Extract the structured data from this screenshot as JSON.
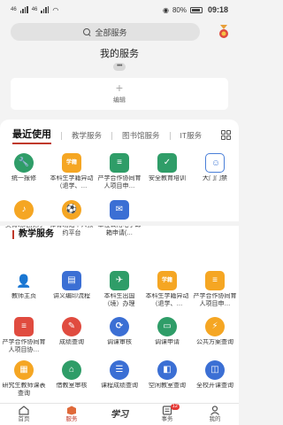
{
  "status_bar": {
    "network_left": "46",
    "network_right": "46",
    "battery": "80%",
    "time": "09:18"
  },
  "header": {
    "search_placeholder": "全部服务",
    "my_services_title": "我的服务",
    "more_dots": "•••",
    "edit_label": "编辑"
  },
  "tabs": {
    "active": "最近使用",
    "items": [
      "教学服务",
      "图书馆服务",
      "IT服务"
    ]
  },
  "recent_apps": [
    {
      "label": "统一报修",
      "icon": "wrench-icon",
      "color": "#2f9d68"
    },
    {
      "label": "本科生学籍异动（退学、…",
      "icon": "student-status-icon",
      "color": "#f5a623"
    },
    {
      "label": "产学合作协同育人项目申…",
      "icon": "document-icon",
      "color": "#2f9d68"
    },
    {
      "label": "安全教育培训",
      "icon": "shield-check-icon",
      "color": "#2f9d68"
    },
    {
      "label": "大门门禁",
      "icon": "face-scan-icon",
      "color": "#4a7fd8"
    },
    {
      "label": "美育场地预约",
      "icon": "venue-icon",
      "color": "#f5a623"
    },
    {
      "label": "体育场馆个人预约平台",
      "icon": "sports-venue-icon",
      "color": "#f5a623"
    },
    {
      "label": "单位公用电子邮箱申请(…",
      "icon": "mail-icon",
      "color": "#3b6fd4"
    }
  ],
  "teaching_section_title": "教学服务",
  "teaching_apps": [
    {
      "label": "教师主页",
      "icon": "teacher-icon",
      "color": "#e04b3f"
    },
    {
      "label": "讲义编印流程",
      "icon": "lecture-print-icon",
      "color": "#3b6fd4"
    },
    {
      "label": "本科生出国（境）办理",
      "icon": "travel-icon",
      "color": "#2f9d68"
    },
    {
      "label": "本科生学籍异动（退学、…",
      "icon": "student-status-icon",
      "color": "#f5a623"
    },
    {
      "label": "产学合作协同育人项目申…",
      "icon": "document-icon",
      "color": "#f5a623"
    },
    {
      "label": "产学合作协同育人项目协…",
      "icon": "document-icon",
      "color": "#e04b3f"
    },
    {
      "label": "成绩查询",
      "icon": "grade-query-icon",
      "color": "#e04b3f"
    },
    {
      "label": "调课审核",
      "icon": "course-audit-icon",
      "color": "#3b6fd4"
    },
    {
      "label": "调课申请",
      "icon": "course-apply-icon",
      "color": "#2f9d68"
    },
    {
      "label": "公共方案查询",
      "icon": "plan-query-icon",
      "color": "#f5a623"
    },
    {
      "label": "研究生教师课表查询",
      "icon": "schedule-icon",
      "color": "#f5a623"
    },
    {
      "label": "借教室审核",
      "icon": "classroom-audit-icon",
      "color": "#2f9d68"
    },
    {
      "label": "课程成绩查询",
      "icon": "course-grade-icon",
      "color": "#3b6fd4"
    },
    {
      "label": "空闲教室查询",
      "icon": "free-room-icon",
      "color": "#3b6fd4"
    },
    {
      "label": "全校开课查询",
      "icon": "course-list-icon",
      "color": "#3b6fd4"
    }
  ],
  "bottom_nav": {
    "home": "首页",
    "services": "服务",
    "center_logo": "学习",
    "affairs": "事务",
    "affairs_badge": "12",
    "mine": "我的"
  }
}
